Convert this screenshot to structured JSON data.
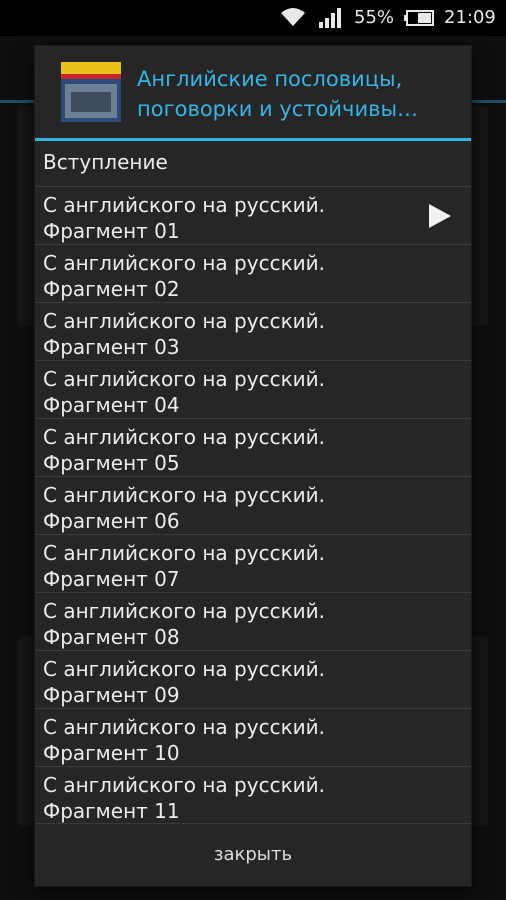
{
  "status_bar": {
    "battery_percent": "55%",
    "time": "21:09",
    "icons": [
      "wifi-icon",
      "signal-icon",
      "battery-icon"
    ]
  },
  "dialog": {
    "title_line1": "Английские пословицы,",
    "title_line2": "поговорки и устойчивы…",
    "items": [
      {
        "line1": "Вступление",
        "line2": ""
      },
      {
        "line1": "С английского на русский.",
        "line2": "Фрагмент 01",
        "playing": true
      },
      {
        "line1": "С английского на русский.",
        "line2": "Фрагмент 02"
      },
      {
        "line1": "С английского на русский.",
        "line2": "Фрагмент 03"
      },
      {
        "line1": "С английского на русский.",
        "line2": "Фрагмент 04"
      },
      {
        "line1": "С английского на русский.",
        "line2": "Фрагмент 05"
      },
      {
        "line1": "С английского на русский.",
        "line2": "Фрагмент 06"
      },
      {
        "line1": "С английского на русский.",
        "line2": "Фрагмент 07"
      },
      {
        "line1": "С английского на русский.",
        "line2": "Фрагмент 08"
      },
      {
        "line1": "С английского на русский.",
        "line2": "Фрагмент 09"
      },
      {
        "line1": "С английского на русский.",
        "line2": "Фрагмент 10"
      },
      {
        "line1": "С английского на русский.",
        "line2": "Фрагмент 11"
      }
    ],
    "close_label": "закрыть"
  },
  "colors": {
    "accent": "#33b5e5",
    "dialog_bg": "#262626",
    "text": "#ececec"
  }
}
